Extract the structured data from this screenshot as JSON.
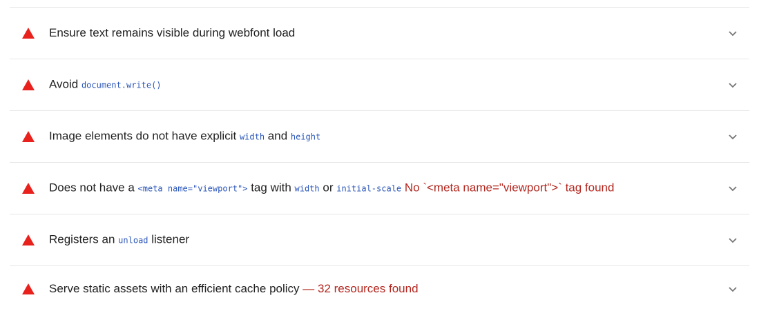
{
  "audits": [
    {
      "parts": [
        {
          "type": "text",
          "value": "Ensure text remains visible during webfont load"
        }
      ]
    },
    {
      "parts": [
        {
          "type": "text",
          "value": "Avoid "
        },
        {
          "type": "code",
          "value": "document.write()"
        }
      ]
    },
    {
      "parts": [
        {
          "type": "text",
          "value": "Image elements do not have explicit "
        },
        {
          "type": "code",
          "value": "width"
        },
        {
          "type": "text",
          "value": " and "
        },
        {
          "type": "code",
          "value": "height"
        }
      ]
    },
    {
      "parts": [
        {
          "type": "text",
          "value": "Does not have a "
        },
        {
          "type": "code",
          "value": "<meta name=\"viewport\">"
        },
        {
          "type": "text",
          "value": " tag with "
        },
        {
          "type": "code",
          "value": "width"
        },
        {
          "type": "text",
          "value": " or "
        },
        {
          "type": "code",
          "value": "initial-scale"
        },
        {
          "type": "text",
          "value": " "
        },
        {
          "type": "display",
          "value": "No `<meta name=\"viewport\">` tag found"
        }
      ]
    },
    {
      "parts": [
        {
          "type": "text",
          "value": "Registers an "
        },
        {
          "type": "code",
          "value": "unload"
        },
        {
          "type": "text",
          "value": " listener"
        }
      ]
    },
    {
      "parts": [
        {
          "type": "text",
          "value": "Serve static assets with an efficient cache policy "
        },
        {
          "type": "display",
          "value": " — 32 resources found"
        }
      ]
    }
  ],
  "icons": {
    "status": "fail-triangle-icon",
    "expand": "chevron-down-icon"
  },
  "colors": {
    "fail": "#e8211d",
    "code": "#2a55b8",
    "display_value": "#b3261e",
    "divider": "#e6e6e6",
    "text": "#212121"
  }
}
